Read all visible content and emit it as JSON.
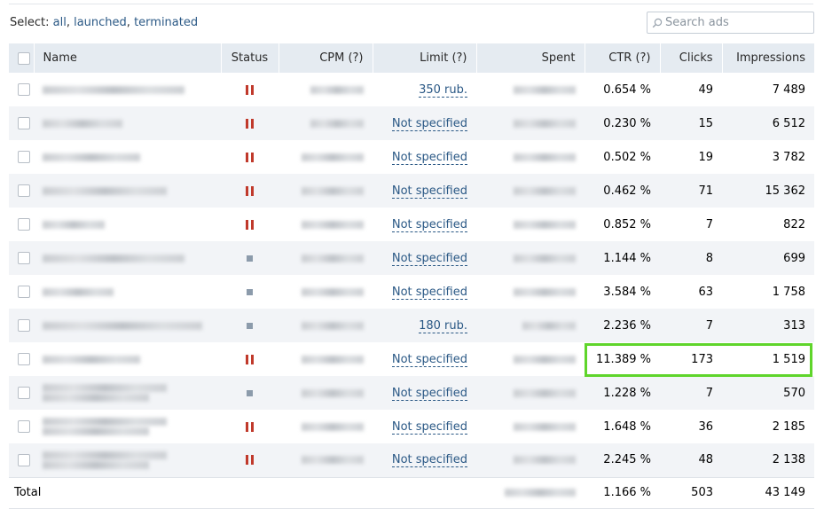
{
  "select_bar": {
    "prefix": "Select: ",
    "all": "all",
    "sep1": ", ",
    "launched": "launched",
    "sep2": ", ",
    "terminated": "terminated"
  },
  "search": {
    "placeholder": "Search ads",
    "icon": "search-icon"
  },
  "columns": {
    "name": "Name",
    "status": "Status",
    "cpm": "CPM (?)",
    "limit": "Limit (?)",
    "spent": "Spent",
    "ctr": "CTR (?)",
    "clicks": "Clicks",
    "impressions": "Impressions"
  },
  "status_legend": {
    "paused": "pause-icon",
    "stopped": "stopped-square-icon"
  },
  "colors": {
    "paused": "#c0392b",
    "stopped": "#8c9bab",
    "link": "#2a5885",
    "highlight": "#5fd52b",
    "header_bg": "#e5ebf1"
  },
  "rows": [
    {
      "status": "paused",
      "limit": "350 rub.",
      "ctr": "0.654 %",
      "clicks": "49",
      "impressions": "7 489"
    },
    {
      "status": "paused",
      "limit": "Not specified",
      "ctr": "0.230 %",
      "clicks": "15",
      "impressions": "6 512"
    },
    {
      "status": "paused",
      "limit": "Not specified",
      "ctr": "0.502 %",
      "clicks": "19",
      "impressions": "3 782"
    },
    {
      "status": "paused",
      "limit": "Not specified",
      "ctr": "0.462 %",
      "clicks": "71",
      "impressions": "15 362"
    },
    {
      "status": "paused",
      "limit": "Not specified",
      "ctr": "0.852 %",
      "clicks": "7",
      "impressions": "822"
    },
    {
      "status": "stopped",
      "limit": "Not specified",
      "ctr": "1.144 %",
      "clicks": "8",
      "impressions": "699"
    },
    {
      "status": "stopped",
      "limit": "Not specified",
      "ctr": "3.584 %",
      "clicks": "63",
      "impressions": "1 758"
    },
    {
      "status": "stopped",
      "limit": "180 rub.",
      "ctr": "2.236 %",
      "clicks": "7",
      "impressions": "313"
    },
    {
      "status": "paused",
      "limit": "Not specified",
      "ctr": "11.389 %",
      "clicks": "173",
      "impressions": "1 519"
    },
    {
      "status": "stopped",
      "limit": "Not specified",
      "ctr": "1.228 %",
      "clicks": "7",
      "impressions": "570"
    },
    {
      "status": "paused",
      "limit": "Not specified",
      "ctr": "1.648 %",
      "clicks": "36",
      "impressions": "2 185"
    },
    {
      "status": "paused",
      "limit": "Not specified",
      "ctr": "2.245 %",
      "clicks": "48",
      "impressions": "2 138"
    }
  ],
  "total": {
    "label": "Total",
    "ctr": "1.166 %",
    "clicks": "503",
    "impressions": "43 149"
  }
}
